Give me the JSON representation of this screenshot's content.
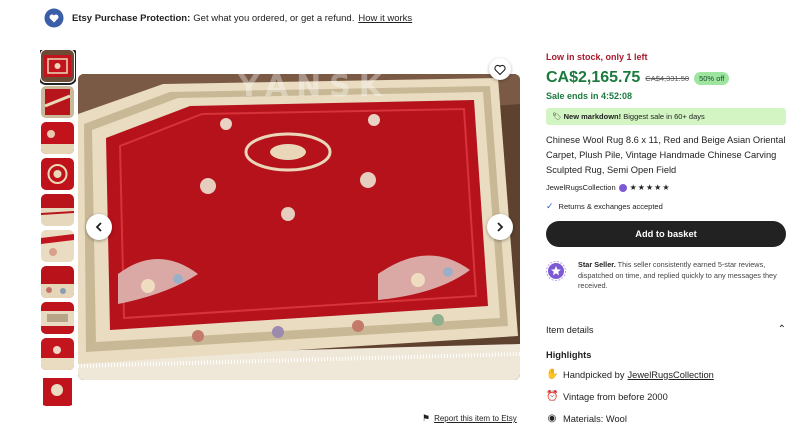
{
  "protection": {
    "title": "Etsy Purchase Protection:",
    "text": "Get what you ordered, or get a refund.",
    "link": "How it works",
    "icon": "hand-heart-icon"
  },
  "gallery": {
    "thumbnail_count": 10,
    "prev_icon": "chevron-left-icon",
    "next_icon": "chevron-right-icon",
    "favorite_icon": "heart-icon",
    "watermark": "YANSK"
  },
  "report": {
    "label": "Report this item to Etsy",
    "icon": "flag-icon"
  },
  "listing": {
    "stock": "Low in stock, only 1 left",
    "price": "CA$2,165.75",
    "original_price": "CA$4,331.50",
    "discount": "50% off",
    "sale_ends": "Sale ends in 4:52:08",
    "markdown_bold": "New markdown!",
    "markdown_text": "Biggest sale in 60+ days",
    "title": "Chinese Wool Rug 8.6 x 11, Red and Beige Asian Oriental Carpet, Plush Pile, Vintage Handmade Chinese Carving Sculpted Rug, Semi Open Field",
    "shop_name": "JewelRugsCollection",
    "stars": "★★★★★",
    "rating": 5,
    "returns": "Returns & exchanges accepted",
    "add_to_basket": "Add to basket",
    "star_seller_title": "Star Seller.",
    "star_seller_text": "This seller consistently earned 5-star reviews, dispatched on time, and replied quickly to any messages they received.",
    "item_details": "Item details",
    "highlights_title": "Highlights",
    "handpicked_prefix": "Handpicked by",
    "handpicked_shop": "JewelRugsCollection",
    "vintage": "Vintage from before 2000",
    "materials": "Materials: Wool"
  },
  "colors": {
    "price_green": "#1b7a3e",
    "stock_red": "#a61a2e",
    "rug_red": "#b5121b",
    "rug_beige": "#e9dcc0"
  }
}
